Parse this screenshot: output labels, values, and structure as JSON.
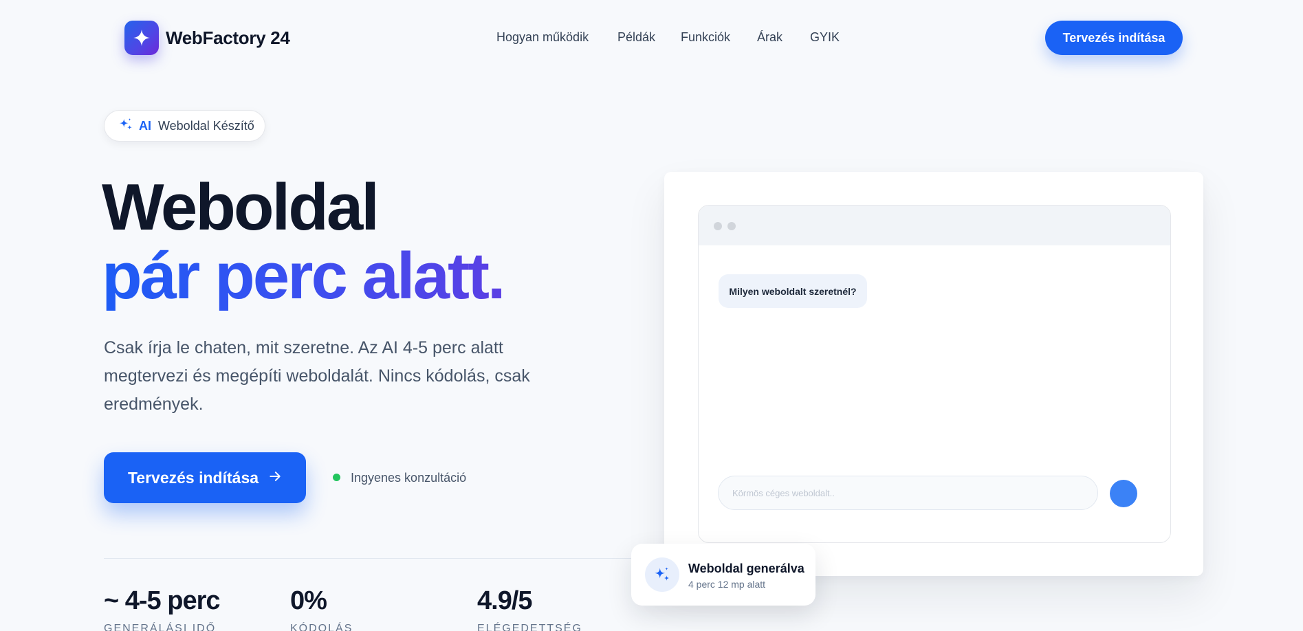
{
  "brand": {
    "name": "WebFactory 24",
    "icon": "sparkle-icon"
  },
  "nav": {
    "links": [
      "Hogyan működik",
      "Példák",
      "Funkciók",
      "Árak",
      "GYIK"
    ],
    "cta": "Tervezés indítása"
  },
  "hero": {
    "badge": {
      "ai": "AI",
      "text": "Weboldal Készítő"
    },
    "title_line1": "Weboldal",
    "title_line2": "pár perc alatt.",
    "lead": "Csak írja le chaten, mit szeretne. Az AI 4-5 perc alatt megtervezi és megépíti weboldalát. Nincs kódolás, csak eredmények.",
    "cta": "Tervezés indítása",
    "cta_icon": "arrow-right-icon",
    "free_note": "Ingyenes konzultáció"
  },
  "stats": [
    {
      "value": "~ 4-5 perc",
      "label": "GENERÁLÁSI IDŐ"
    },
    {
      "value": "0%",
      "label": "KÓDOLÁS"
    },
    {
      "value": "4.9/5",
      "label": "ELÉGEDETTSÉG"
    }
  ],
  "mockup": {
    "question": "Milyen weboldalt szeretnél?",
    "input_placeholder": "Körmös céges weboldalt.."
  },
  "toast": {
    "title": "Weboldal generálva",
    "subtitle": "4 perc 12 mp alatt"
  },
  "colors": {
    "accent": "#1a62f5",
    "success": "#22c55e",
    "text": "#0f172a"
  }
}
